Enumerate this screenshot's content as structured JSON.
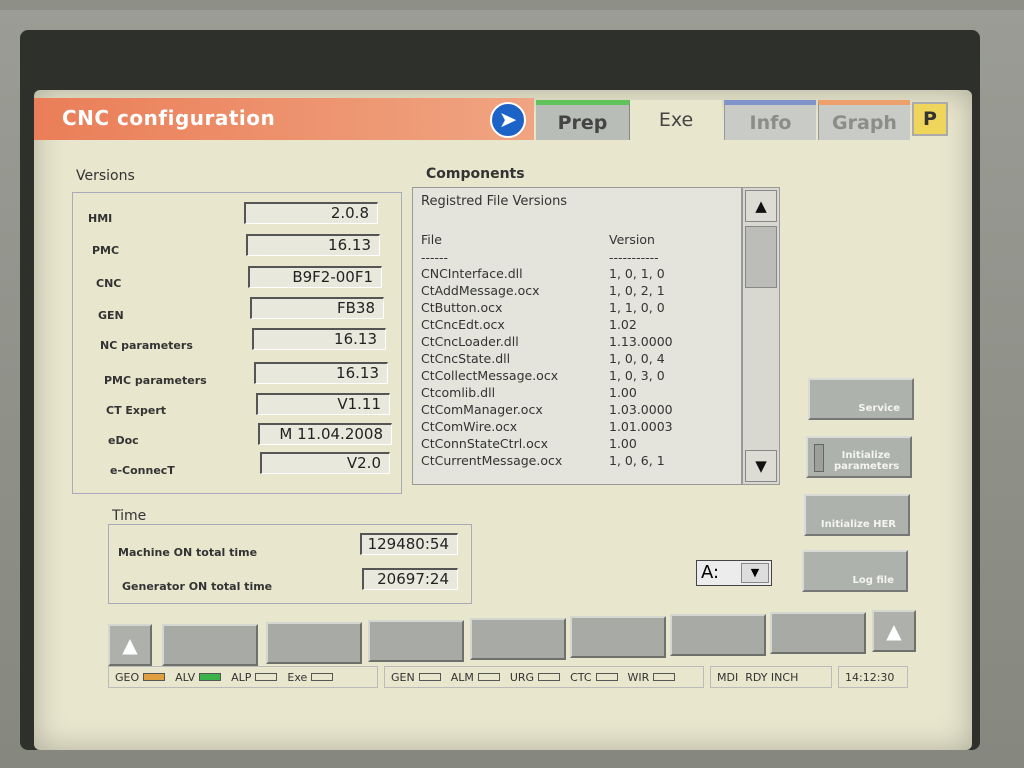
{
  "window": {
    "title": "CNC configuration",
    "tabs": {
      "prep": "Prep",
      "exe": "Exe",
      "info": "Info",
      "graph": "Graph",
      "p": "P"
    }
  },
  "versions": {
    "heading": "Versions",
    "items": [
      {
        "label": "HMI",
        "value": "2.0.8"
      },
      {
        "label": "PMC",
        "value": "16.13"
      },
      {
        "label": "CNC",
        "value": "B9F2-00F1"
      },
      {
        "label": "GEN",
        "value": "FB38"
      },
      {
        "label": "NC parameters",
        "value": "16.13"
      },
      {
        "label": "PMC parameters",
        "value": "16.13"
      },
      {
        "label": "CT Expert",
        "value": "V1.11"
      },
      {
        "label": "eDoc",
        "value": "M 11.04.2008"
      },
      {
        "label": "e-ConnecT",
        "value": "V2.0"
      }
    ]
  },
  "components": {
    "heading": "Components",
    "list_title": "Registred File Versions",
    "col_file": "File",
    "col_version": "Version",
    "sep_file": "------",
    "sep_version": "-----------",
    "rows": [
      {
        "file": "CNCInterface.dll",
        "version": "1, 0, 1, 0"
      },
      {
        "file": "CtAddMessage.ocx",
        "version": "1, 0, 2, 1"
      },
      {
        "file": "CtButton.ocx",
        "version": "1, 1, 0, 0"
      },
      {
        "file": "CtCncEdt.ocx",
        "version": "1.02"
      },
      {
        "file": "CtCncLoader.dll",
        "version": "1.13.0000"
      },
      {
        "file": "CtCncState.dll",
        "version": "1, 0, 0, 4"
      },
      {
        "file": "CtCollectMessage.ocx",
        "version": "1, 0, 3, 0"
      },
      {
        "file": "Ctcomlib.dll",
        "version": "1.00"
      },
      {
        "file": "CtComManager.ocx",
        "version": "1.03.0000"
      },
      {
        "file": "CtComWire.ocx",
        "version": "1.01.0003"
      },
      {
        "file": "CtConnStateCtrl.ocx",
        "version": "1.00"
      },
      {
        "file": "CtCurrentMessage.ocx",
        "version": "1, 0, 6, 1"
      }
    ]
  },
  "time": {
    "heading": "Time",
    "machine_label": "Machine ON total time",
    "machine_value": "129480:54",
    "generator_label": "Generator ON total time",
    "generator_value": "20697:24"
  },
  "side_buttons": {
    "service": "Service",
    "init_params": "Initialize parameters",
    "init_her": "Initialize HER",
    "log_file": "Log file"
  },
  "drive": {
    "value": "A:"
  },
  "status": {
    "group1": [
      "GEO",
      "ALV",
      "ALP",
      "Exe"
    ],
    "group2": [
      "GEN",
      "ALM",
      "URG",
      "CTC",
      "WIR"
    ],
    "mode": "MDI  RDY INCH",
    "clock": "14:12:30",
    "colors": {
      "geo": "#e0a040",
      "alv": "#3bb24a"
    }
  }
}
